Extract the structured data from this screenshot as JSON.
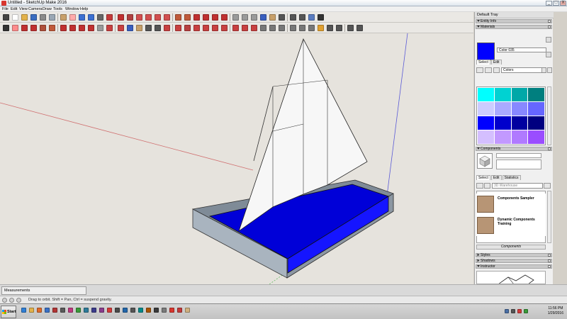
{
  "window": {
    "title": "Untitled - SketchUp Make 2016",
    "min": "_",
    "max": "□",
    "close": "X"
  },
  "menu": [
    "File",
    "Edit",
    "View",
    "Camera",
    "Draw",
    "Tools",
    "Window",
    "Help"
  ],
  "toolbar_row1": [
    {
      "icon": "select-arrow-icon",
      "color": "#444444"
    },
    {
      "icon": "new-file-icon",
      "color": "#ffffff"
    },
    {
      "icon": "open-folder-icon",
      "color": "#e3b24a"
    },
    {
      "icon": "save-icon",
      "color": "#3a6cc0"
    },
    {
      "icon": "cut-icon",
      "color": "#8a8a8a"
    },
    {
      "icon": "copy-icon",
      "color": "#9aa7b5"
    },
    {
      "icon": "paste-icon",
      "color": "#c8a06a"
    },
    {
      "icon": "erase-icon",
      "color": "#ffaaaa"
    },
    {
      "icon": "undo-icon",
      "color": "#3b6fd1"
    },
    {
      "icon": "redo-icon",
      "color": "#3b6fd1"
    },
    {
      "icon": "print-icon",
      "color": "#666666"
    },
    {
      "icon": "model-info-icon",
      "color": "#c43a3a"
    },
    {
      "icon": "line-icon",
      "color": "#c03030"
    },
    {
      "icon": "freehand-icon",
      "color": "#b04040"
    },
    {
      "icon": "rectangle-icon",
      "color": "#d24f4f"
    },
    {
      "icon": "circle-icon",
      "color": "#d24f4f"
    },
    {
      "icon": "polygon-icon",
      "color": "#d24f4f"
    },
    {
      "icon": "arc-icon",
      "color": "#d24f4f"
    },
    {
      "icon": "pushpull-icon",
      "color": "#c05a3a"
    },
    {
      "icon": "follow-me-icon",
      "color": "#c05a3a"
    },
    {
      "icon": "move-icon",
      "color": "#c03030"
    },
    {
      "icon": "rotate-icon",
      "color": "#c03030"
    },
    {
      "icon": "scale-icon",
      "color": "#c03030"
    },
    {
      "icon": "offset-icon",
      "color": "#c03030"
    },
    {
      "icon": "iso-view-icon",
      "color": "#9a9a9a"
    },
    {
      "icon": "top-view-icon",
      "color": "#9a9a9a"
    },
    {
      "icon": "front-view-icon",
      "color": "#9a9a9a"
    },
    {
      "icon": "orbit-icon",
      "color": "#3a5fbf"
    },
    {
      "icon": "pan-icon",
      "color": "#c8a06a"
    },
    {
      "icon": "zoom-icon",
      "color": "#555555"
    },
    {
      "icon": "zoom-window-icon",
      "color": "#555555"
    },
    {
      "icon": "zoom-extents-icon",
      "color": "#555555"
    },
    {
      "icon": "previous-view-icon",
      "color": "#5a7cc0"
    },
    {
      "icon": "walk-icon",
      "color": "#333333"
    }
  ],
  "toolbar_row2": [
    {
      "icon": "select-icon",
      "color": "#333333"
    },
    {
      "icon": "eraser-icon",
      "color": "#ff8c8c"
    },
    {
      "icon": "line-tool-icon",
      "color": "#c03030"
    },
    {
      "icon": "arc-tool-icon",
      "color": "#c03030"
    },
    {
      "icon": "shapes-icon",
      "color": "#b0503a"
    },
    {
      "icon": "pushpull-tool-icon",
      "color": "#c05a3a"
    },
    {
      "icon": "offset-tool-icon",
      "color": "#c03030"
    },
    {
      "icon": "move-tool-icon",
      "color": "#c03030"
    },
    {
      "icon": "rotate-tool-icon",
      "color": "#c03030"
    },
    {
      "icon": "scale-tool-icon",
      "color": "#c03030"
    },
    {
      "icon": "tape-icon",
      "color": "#9a9a9a"
    },
    {
      "icon": "text-icon",
      "color": "#c84040"
    },
    {
      "icon": "paint-bucket-icon",
      "color": "#c84040"
    },
    {
      "icon": "orbit-tool-icon",
      "color": "#3a5fbf"
    },
    {
      "icon": "pan-tool-icon",
      "color": "#c8a06a"
    },
    {
      "icon": "zoom-tool-icon",
      "color": "#555555"
    },
    {
      "icon": "zoom-extents-tool-icon",
      "color": "#555555"
    },
    {
      "icon": "warehouse-icon",
      "color": "#c84040"
    },
    {
      "icon": "share-model-icon",
      "color": "#c84040"
    },
    {
      "icon": "extension-warehouse-icon",
      "color": "#b84040"
    },
    {
      "icon": "layout-icon",
      "color": "#c84040"
    },
    {
      "icon": "iso-icon",
      "color": "#c84040"
    },
    {
      "icon": "top-icon",
      "color": "#c84040"
    },
    {
      "icon": "front-icon",
      "color": "#c84040"
    },
    {
      "icon": "right-icon",
      "color": "#c84040"
    },
    {
      "icon": "back-icon",
      "color": "#c84040"
    },
    {
      "icon": "left-icon",
      "color": "#c84040"
    },
    {
      "icon": "xray-icon",
      "color": "#777777"
    },
    {
      "icon": "wireframe-icon",
      "color": "#777777"
    },
    {
      "icon": "hidden-line-icon",
      "color": "#777777"
    },
    {
      "icon": "shaded-icon",
      "color": "#777777"
    },
    {
      "icon": "textures-icon",
      "color": "#777777"
    },
    {
      "icon": "monochrome-icon",
      "color": "#777777"
    },
    {
      "icon": "section-plane-icon",
      "color": "#e0a030"
    },
    {
      "icon": "dimensions-icon",
      "color": "#555555"
    },
    {
      "icon": "protractor-icon",
      "color": "#555555"
    },
    {
      "icon": "axes-icon",
      "color": "#555555"
    },
    {
      "icon": "3d-text-icon",
      "color": "#555555"
    }
  ],
  "tray": {
    "title": "Default Tray",
    "entity_info": "Entity Info",
    "materials": {
      "header": "Materials",
      "material_name": "Color 035",
      "current_color": "#0000ff",
      "tab_select": "Select",
      "tab_edit": "Edit",
      "library": "Colors",
      "swatches": [
        "#00ffff",
        "#00d2d2",
        "#00a8a8",
        "#007f7f",
        "#ccccff",
        "#aaaaff",
        "#8888ff",
        "#6666ff",
        "#0000ff",
        "#0000cc",
        "#0000a0",
        "#000080",
        "#d4bfff",
        "#c299ff",
        "#b07aff",
        "#9a4dff"
      ]
    },
    "components": {
      "header": "Components",
      "tab_select": "Select",
      "tab_edit": "Edit",
      "tab_statistics": "Statistics",
      "search_placeholder": "3D Warehouse",
      "items": [
        {
          "label": "Components Sampler"
        },
        {
          "label": "Dynamic Components Training"
        }
      ],
      "footer": "Components"
    },
    "styles": "Styles",
    "shadows": "Shadows",
    "instructor": "Instructor"
  },
  "measurements": {
    "label": "Measurements"
  },
  "status": {
    "hint": "Drag to orbit. Shift = Pan, Ctrl = suspend gravity."
  },
  "taskbar": {
    "start": "Start",
    "time": "11:56 PM",
    "date": "1/29/2016",
    "icons": [
      {
        "icon": "ie-icon",
        "color": "#2f7fd6"
      },
      {
        "icon": "explorer-icon",
        "color": "#e3b24a"
      },
      {
        "icon": "media-icon",
        "color": "#e06a2a"
      },
      {
        "icon": "app-icon-1",
        "color": "#3a70c6"
      },
      {
        "icon": "app-icon-2",
        "color": "#b23535"
      },
      {
        "icon": "app-icon-3",
        "color": "#5a5a5a"
      },
      {
        "icon": "app-icon-4",
        "color": "#c03a80"
      },
      {
        "icon": "app-icon-5",
        "color": "#3a9a3a"
      },
      {
        "icon": "app-icon-6",
        "color": "#2d7b9a"
      },
      {
        "icon": "app-icon-7",
        "color": "#3c3c8c"
      },
      {
        "icon": "app-icon-8",
        "color": "#8a3c8c"
      },
      {
        "icon": "app-icon-9",
        "color": "#d43a3a"
      },
      {
        "icon": "app-icon-10",
        "color": "#4a4a4a"
      },
      {
        "icon": "app-icon-11",
        "color": "#2266aa"
      },
      {
        "icon": "app-icon-12",
        "color": "#555555"
      },
      {
        "icon": "app-icon-13",
        "color": "#008a8a"
      },
      {
        "icon": "app-icon-14",
        "color": "#aa5500"
      },
      {
        "icon": "app-icon-15",
        "color": "#3a3a3a"
      },
      {
        "icon": "app-icon-16",
        "color": "#7a7a7a"
      },
      {
        "icon": "sketchup-taskbar-icon",
        "color": "#d8362e"
      },
      {
        "icon": "app-icon-17",
        "color": "#c43a3a"
      },
      {
        "icon": "app-icon-18",
        "color": "#d0b080"
      }
    ],
    "tray_icons": [
      {
        "icon": "network-icon",
        "color": "#4a6fa5"
      },
      {
        "icon": "volume-icon",
        "color": "#555555"
      },
      {
        "icon": "flag-icon",
        "color": "#d43a3a"
      },
      {
        "icon": "power-icon",
        "color": "#3a9a3a"
      }
    ]
  }
}
